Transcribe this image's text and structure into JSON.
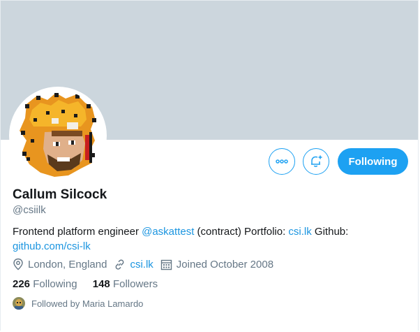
{
  "profile": {
    "name": "Callum Silcock",
    "handle": "@csiilk",
    "bio_prefix": "Frontend platform engineer ",
    "bio_mention": "@askattest",
    "bio_middle": " (contract) Portfolio: ",
    "bio_portfolio": "csi.lk",
    "bio_github_label": " Github:",
    "bio_github_link": "github.com/csi-lk"
  },
  "meta": {
    "location": "London, England",
    "website": "csi.lk",
    "joined": "Joined October 2008"
  },
  "stats": {
    "following_count": "226",
    "following_label": "Following",
    "followers_count": "148",
    "followers_label": "Followers"
  },
  "followed_by": "Followed by Maria Lamardo",
  "actions": {
    "follow_label": "Following"
  },
  "icons": {
    "more": "more-icon",
    "notify": "bell-plus-icon",
    "location": "location-pin-icon",
    "link": "link-icon",
    "calendar": "calendar-icon"
  },
  "colors": {
    "accent": "#1da1f2",
    "banner": "#ccd6dd",
    "secondary_text": "#657786",
    "primary_text": "#14171a",
    "link": "#1b95e0"
  }
}
